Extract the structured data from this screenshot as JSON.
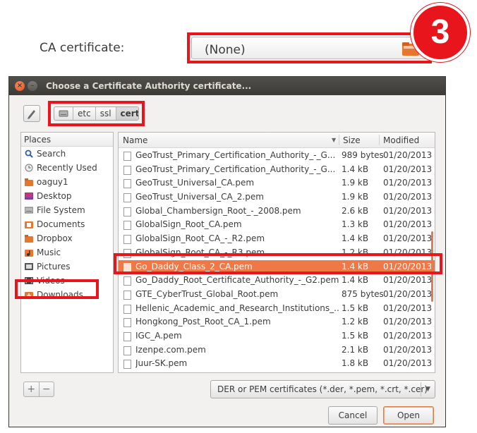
{
  "top": {
    "label": "CA certificate:",
    "value": "(None)",
    "step_badge": "3"
  },
  "dialog": {
    "title": "Choose a Certificate Authority certificate...",
    "path": [
      "etc",
      "ssl",
      "certs"
    ],
    "places_header": "Places",
    "places": [
      {
        "label": "Search",
        "icon": "search-icon"
      },
      {
        "label": "Recently Used",
        "icon": "clock-icon"
      },
      {
        "label": "oaguy1",
        "icon": "home-folder-icon"
      },
      {
        "label": "Desktop",
        "icon": "desktop-icon"
      },
      {
        "label": "File System",
        "icon": "drive-icon"
      },
      {
        "label": "Documents",
        "icon": "documents-folder-icon"
      },
      {
        "label": "Dropbox",
        "icon": "folder-icon"
      },
      {
        "label": "Music",
        "icon": "music-folder-icon"
      },
      {
        "label": "Pictures",
        "icon": "pictures-folder-icon"
      },
      {
        "label": "Videos",
        "icon": "videos-folder-icon"
      },
      {
        "label": "Downloads",
        "icon": "downloads-folder-icon"
      }
    ],
    "columns": {
      "name": "Name",
      "size": "Size",
      "modified": "Modified"
    },
    "files": [
      {
        "name": "GeoTrust_Primary_Certification_Authority_-_G...",
        "size": "989 bytes",
        "modified": "01/20/2013"
      },
      {
        "name": "GeoTrust_Primary_Certification_Authority_-_G...",
        "size": "1.4 kB",
        "modified": "01/20/2013"
      },
      {
        "name": "GeoTrust_Universal_CA.pem",
        "size": "1.9 kB",
        "modified": "01/20/2013"
      },
      {
        "name": "GeoTrust_Universal_CA_2.pem",
        "size": "1.9 kB",
        "modified": "01/20/2013"
      },
      {
        "name": "Global_Chambersign_Root_-_2008.pem",
        "size": "2.6 kB",
        "modified": "01/20/2013"
      },
      {
        "name": "GlobalSign_Root_CA.pem",
        "size": "1.3 kB",
        "modified": "01/20/2013"
      },
      {
        "name": "GlobalSign_Root_CA_-_R2.pem",
        "size": "1.4 kB",
        "modified": "01/20/2013"
      },
      {
        "name": "GlobalSign_Root_CA_-_R3.pem",
        "size": "1.2 kB",
        "modified": "01/20/2013"
      },
      {
        "name": "Go_Daddy_Class_2_CA.pem",
        "size": "1.4 kB",
        "modified": "01/20/2013",
        "selected": true
      },
      {
        "name": "Go_Daddy_Root_Certificate_Authority_-_G2.pem",
        "size": "1.4 kB",
        "modified": "01/20/2013"
      },
      {
        "name": "GTE_CyberTrust_Global_Root.pem",
        "size": "875 bytes",
        "modified": "01/20/2013"
      },
      {
        "name": "Hellenic_Academic_and_Research_Institutions_...",
        "size": "1.5 kB",
        "modified": "01/20/2013"
      },
      {
        "name": "Hongkong_Post_Root_CA_1.pem",
        "size": "1.2 kB",
        "modified": "01/20/2013"
      },
      {
        "name": "IGC_A.pem",
        "size": "1.5 kB",
        "modified": "01/20/2013"
      },
      {
        "name": "Izenpe.com.pem",
        "size": "2.1 kB",
        "modified": "01/20/2013"
      },
      {
        "name": "Juur-SK.pem",
        "size": "1.8 kB",
        "modified": "01/20/2013"
      }
    ],
    "add_label": "+",
    "remove_label": "−",
    "filter": "DER or PEM certificates (*.der, *.pem, *.crt, *.cer)",
    "cancel_label": "Cancel",
    "open_label": "Open"
  },
  "colors": {
    "annotation_red": "#e8151c",
    "selection_orange": "#f07746",
    "titlebar": "#3c3b37"
  }
}
